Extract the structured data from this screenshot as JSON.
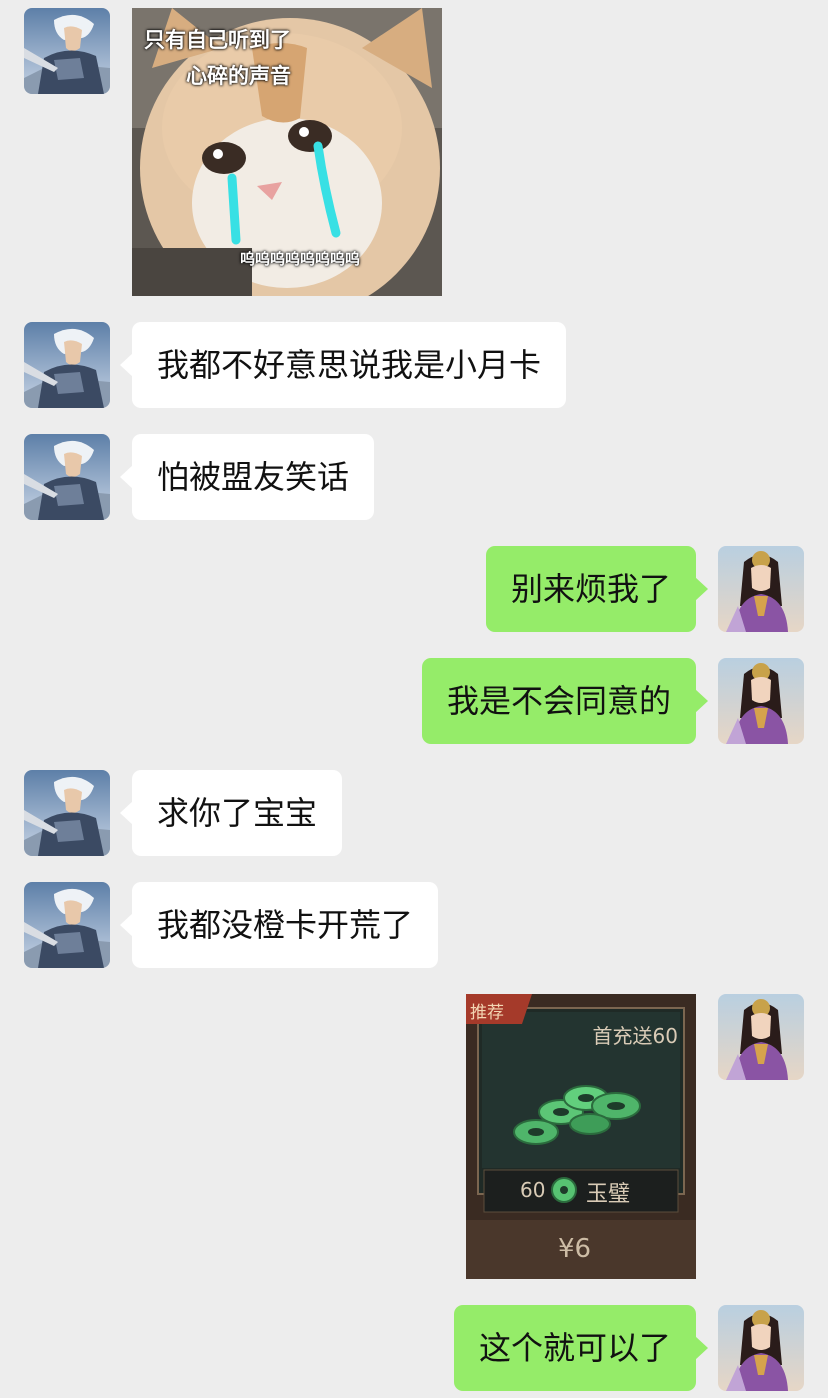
{
  "messages": [
    {
      "side": "left",
      "type": "image",
      "image": "crying-cat-sticker",
      "caption_top_1": "只有自己听到了",
      "caption_top_2": "心碎的声音",
      "caption_bottom": "呜呜呜呜呜呜呜呜"
    },
    {
      "side": "left",
      "type": "text",
      "text": "我都不好意思说我是小月卡"
    },
    {
      "side": "left",
      "type": "text",
      "text": "怕被盟友笑话"
    },
    {
      "side": "right",
      "type": "text",
      "text": "别来烦我了"
    },
    {
      "side": "right",
      "type": "text",
      "text": "我是不会同意的"
    },
    {
      "side": "left",
      "type": "text",
      "text": "求你了宝宝"
    },
    {
      "side": "left",
      "type": "text",
      "text": "我都没橙卡开荒了"
    },
    {
      "side": "right",
      "type": "image",
      "image": "jade-pack-card",
      "tag": "推荐",
      "bonus": "首充送60",
      "amount": "60",
      "currency_name": "玉璧",
      "price": "¥6"
    },
    {
      "side": "right",
      "type": "text",
      "text": "这个就可以了"
    }
  ],
  "avatars": {
    "left": "warrior-avatar",
    "right": "lady-avatar"
  },
  "colors": {
    "background": "#ededed",
    "left_bubble": "#ffffff",
    "right_bubble": "#95ec69"
  }
}
